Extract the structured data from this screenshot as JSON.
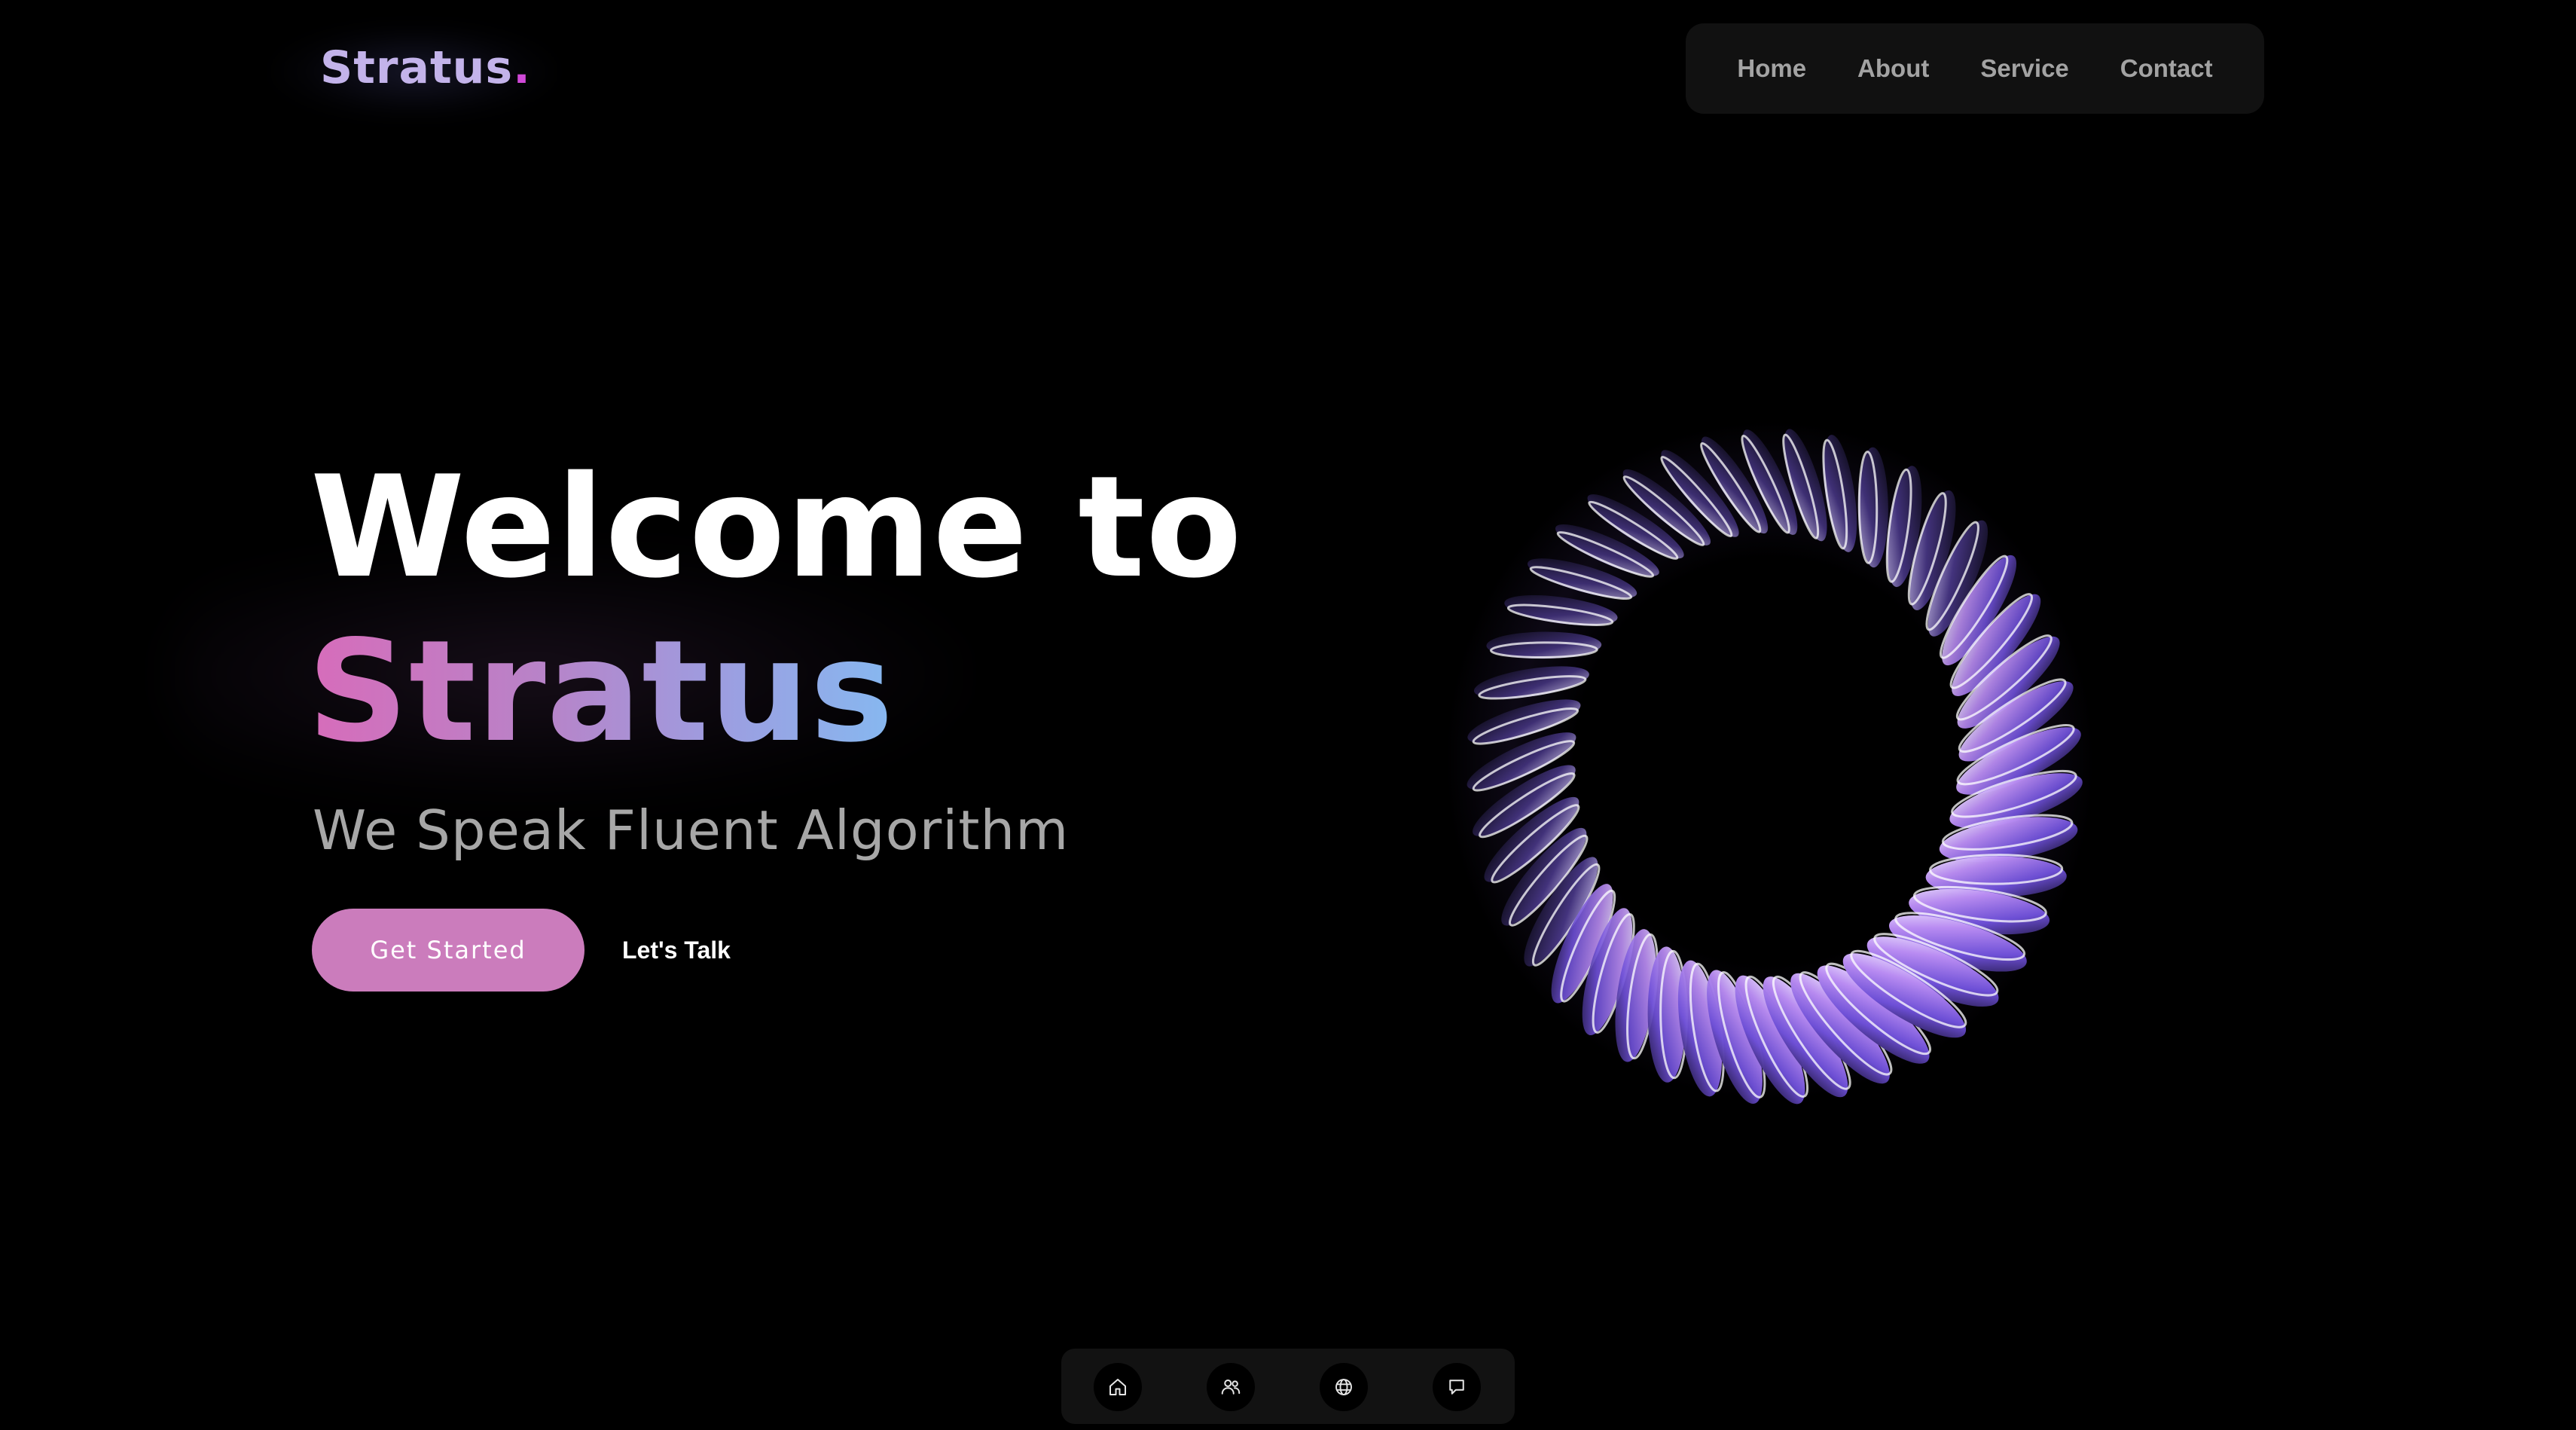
{
  "logo": {
    "word": "Stratus",
    "dot": "."
  },
  "nav": {
    "items": [
      {
        "label": "Home"
      },
      {
        "label": "About"
      },
      {
        "label": "Service"
      },
      {
        "label": "Contact"
      }
    ]
  },
  "hero": {
    "title": "Welcome to",
    "brand": "Stratus",
    "tagline": "We Speak Fluent Algorithm",
    "primary_button": "Get Started",
    "secondary_button": "Let's Talk"
  },
  "dock": {
    "items": [
      {
        "icon": "home-icon"
      },
      {
        "icon": "users-icon"
      },
      {
        "icon": "globe-icon"
      },
      {
        "icon": "message-icon"
      }
    ]
  },
  "colors": {
    "background": "#000000",
    "accent_button": "#cb7cbc",
    "brand_gradient_start": "#d76cba",
    "brand_gradient_end": "#86b8f0",
    "logo_text": "#c3b3ea",
    "logo_dot": "#d049d8",
    "nav_text": "#a3a3a3",
    "tagline_text": "#a7a7a7"
  }
}
